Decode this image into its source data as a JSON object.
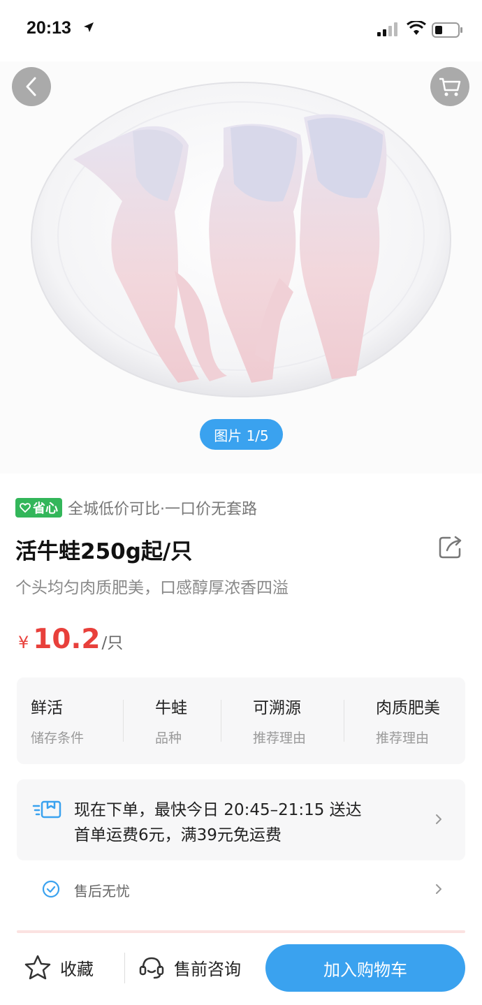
{
  "status_bar": {
    "time": "20:13"
  },
  "gallery": {
    "counter": "图片 1/5"
  },
  "product": {
    "promo_badge": "省心",
    "promo_text": "全城低价可比·一口价无套路",
    "title": "活牛蛙250g起/只",
    "subtitle": "个头均匀肉质肥美，口感醇厚浓香四溢",
    "price": {
      "currency": "¥",
      "amount": "10.2",
      "unit": "/只"
    }
  },
  "attributes": [
    {
      "value": "鲜活",
      "key": "储存条件"
    },
    {
      "value": "牛蛙",
      "key": "品种"
    },
    {
      "value": "可溯源",
      "key": "推荐理由"
    },
    {
      "value": "肉质肥美",
      "key": "推荐理由"
    }
  ],
  "delivery": {
    "line1": "现在下单，最快今日 20:45–21:15 送达",
    "line2": "首单运费6元，满39元免运费"
  },
  "after_sales": {
    "label": "售后无忧"
  },
  "bottom_bar": {
    "favorite_label": "收藏",
    "consult_label": "售前咨询",
    "add_to_cart_label": "加入购物车"
  },
  "colors": {
    "accent": "#3aa2ef",
    "price": "#e8403b",
    "promo_green": "#33b65a"
  }
}
